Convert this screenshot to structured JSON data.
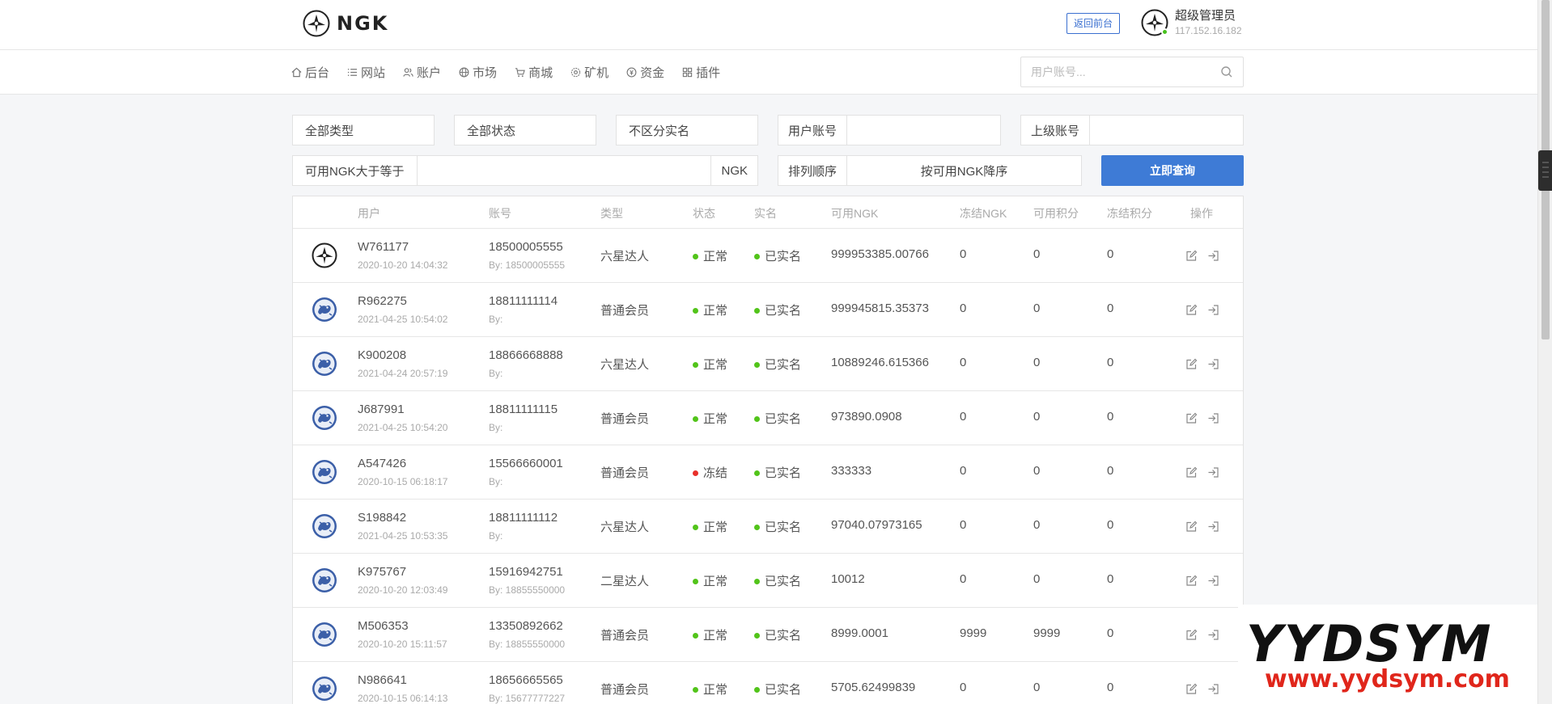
{
  "header": {
    "logo_text": "NGK",
    "back_button": "返回前台",
    "user_name": "超级管理员",
    "user_ip": "117.152.16.182"
  },
  "nav": {
    "items": [
      {
        "label": "后台",
        "icon": "home-icon"
      },
      {
        "label": "网站",
        "icon": "list-icon"
      },
      {
        "label": "账户",
        "icon": "users-icon"
      },
      {
        "label": "市场",
        "icon": "globe-icon"
      },
      {
        "label": "商城",
        "icon": "cart-icon"
      },
      {
        "label": "矿机",
        "icon": "gear-icon"
      },
      {
        "label": "资金",
        "icon": "coin-icon"
      },
      {
        "label": "插件",
        "icon": "grid-icon"
      }
    ],
    "search_placeholder": "用户账号..."
  },
  "filters": {
    "type": "全部类型",
    "status": "全部状态",
    "realname": "不区分实名",
    "user_account_label": "用户账号",
    "parent_account_label": "上级账号",
    "ngk_gte_label": "可用NGK大于等于",
    "ngk_suffix": "NGK",
    "sort_label": "排列顺序",
    "sort_value": "按可用NGK降序",
    "query_button": "立即查询"
  },
  "table": {
    "headers": [
      "用户",
      "账号",
      "类型",
      "状态",
      "实名",
      "可用NGK",
      "冻结NGK",
      "可用积分",
      "冻结积分",
      "操作"
    ],
    "rows": [
      {
        "user": "W761177",
        "date": "2020-10-20 14:04:32",
        "account": "18500005555",
        "by": "By: 18500005555",
        "type": "六星达人",
        "status": "正常",
        "status_color": "#52c41a",
        "realname": "已实名",
        "ngk": "999953385.00766",
        "frozen_ngk": "0",
        "points": "0",
        "frozen_points": "0",
        "avatar": "logo"
      },
      {
        "user": "R962275",
        "date": "2021-04-25 10:54:02",
        "account": "18811111114",
        "by": "By:",
        "type": "普通会员",
        "status": "正常",
        "status_color": "#52c41a",
        "realname": "已实名",
        "ngk": "999945815.35373",
        "frozen_ngk": "0",
        "points": "0",
        "frozen_points": "0",
        "avatar": "blue"
      },
      {
        "user": "K900208",
        "date": "2021-04-24 20:57:19",
        "account": "18866668888",
        "by": "By:",
        "type": "六星达人",
        "status": "正常",
        "status_color": "#52c41a",
        "realname": "已实名",
        "ngk": "10889246.615366",
        "frozen_ngk": "0",
        "points": "0",
        "frozen_points": "0",
        "avatar": "blue"
      },
      {
        "user": "J687991",
        "date": "2021-04-25 10:54:20",
        "account": "18811111115",
        "by": "By:",
        "type": "普通会员",
        "status": "正常",
        "status_color": "#52c41a",
        "realname": "已实名",
        "ngk": "973890.0908",
        "frozen_ngk": "0",
        "points": "0",
        "frozen_points": "0",
        "avatar": "blue"
      },
      {
        "user": "A547426",
        "date": "2020-10-15 06:18:17",
        "account": "15566660001",
        "by": "By:",
        "type": "普通会员",
        "status": "冻结",
        "status_color": "#e8302a",
        "realname": "已实名",
        "ngk": "333333",
        "frozen_ngk": "0",
        "points": "0",
        "frozen_points": "0",
        "avatar": "blue"
      },
      {
        "user": "S198842",
        "date": "2021-04-25 10:53:35",
        "account": "18811111112",
        "by": "By:",
        "type": "六星达人",
        "status": "正常",
        "status_color": "#52c41a",
        "realname": "已实名",
        "ngk": "97040.07973165",
        "frozen_ngk": "0",
        "points": "0",
        "frozen_points": "0",
        "avatar": "blue"
      },
      {
        "user": "K975767",
        "date": "2020-10-20 12:03:49",
        "account": "15916942751",
        "by": "By: 18855550000",
        "type": "二星达人",
        "status": "正常",
        "status_color": "#52c41a",
        "realname": "已实名",
        "ngk": "10012",
        "frozen_ngk": "0",
        "points": "0",
        "frozen_points": "0",
        "avatar": "blue"
      },
      {
        "user": "M506353",
        "date": "2020-10-20 15:11:57",
        "account": "13350892662",
        "by": "By: 18855550000",
        "type": "普通会员",
        "status": "正常",
        "status_color": "#52c41a",
        "realname": "已实名",
        "ngk": "8999.0001",
        "frozen_ngk": "9999",
        "points": "9999",
        "frozen_points": "0",
        "avatar": "blue"
      },
      {
        "user": "N986641",
        "date": "2020-10-15 06:14:13",
        "account": "18656665565",
        "by": "By: 15677777227",
        "type": "普通会员",
        "status": "正常",
        "status_color": "#52c41a",
        "realname": "已实名",
        "ngk": "5705.62499839",
        "frozen_ngk": "0",
        "points": "0",
        "frozen_points": "0",
        "avatar": "blue"
      }
    ]
  },
  "watermark": {
    "big": "YYDSYM",
    "url": "www.yydsym.com"
  },
  "colors": {
    "accent": "#3e7bd6",
    "ok": "#52c41a",
    "frozen": "#e8302a"
  }
}
